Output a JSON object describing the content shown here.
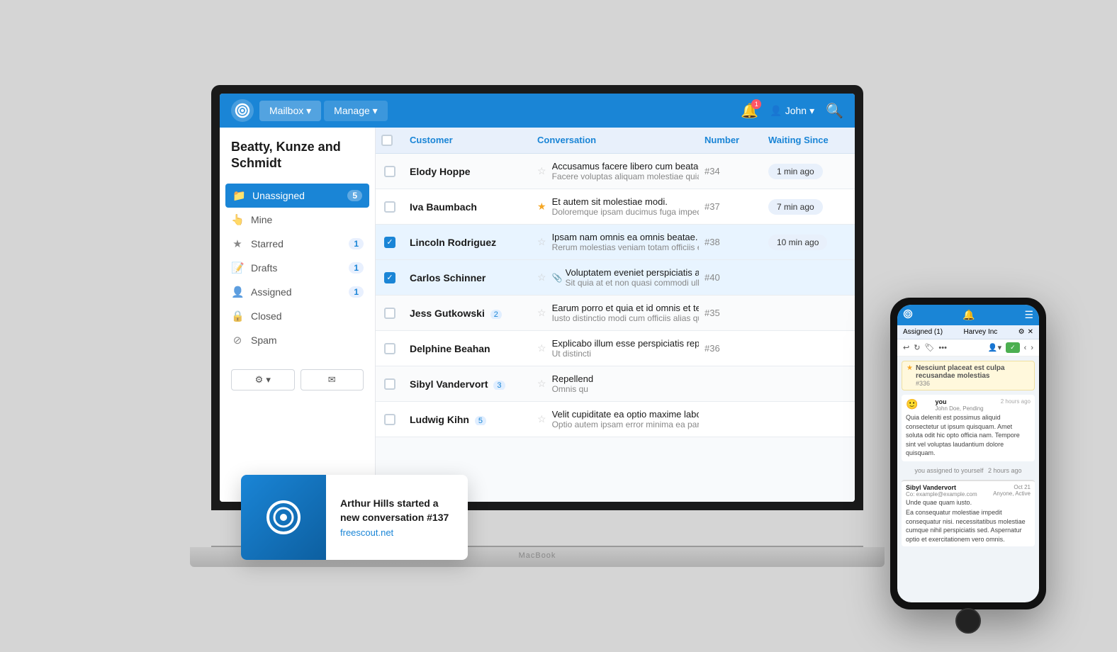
{
  "header": {
    "logo_text": "⟳",
    "nav_items": [
      {
        "label": "Mailbox ▾",
        "id": "mailbox"
      },
      {
        "label": "Manage ▾",
        "id": "manage"
      }
    ],
    "notification_count": "1",
    "user_name": "John",
    "search_label": "🔍"
  },
  "sidebar": {
    "company_name": "Beatty, Kunze and Schmidt",
    "items": [
      {
        "label": "Unassigned",
        "count": "5",
        "icon": "📁",
        "active": true,
        "id": "unassigned"
      },
      {
        "label": "Mine",
        "count": "",
        "icon": "👆",
        "active": false,
        "id": "mine"
      },
      {
        "label": "Starred",
        "count": "1",
        "icon": "★",
        "active": false,
        "id": "starred"
      },
      {
        "label": "Drafts",
        "count": "1",
        "icon": "📝",
        "active": false,
        "id": "drafts"
      },
      {
        "label": "Assigned",
        "count": "1",
        "icon": "👤",
        "active": false,
        "id": "assigned"
      },
      {
        "label": "Closed",
        "count": "",
        "icon": "🔒",
        "active": false,
        "id": "closed"
      },
      {
        "label": "Spam",
        "count": "",
        "icon": "⊘",
        "active": false,
        "id": "spam"
      }
    ],
    "footer_btn1": "⚙ ▾",
    "footer_btn2": "✉"
  },
  "table": {
    "columns": [
      "",
      "Customer",
      "Conversation",
      "Number",
      "Waiting Since"
    ],
    "rows": [
      {
        "id": 1,
        "checked": false,
        "starred": false,
        "customer": "Elody Hoppe",
        "customer_badge": "",
        "conv_title": "Accusamus facere libero cum beatae fugit a",
        "conv_preview": "Facere voluptas aliquam molestiae quia nisi offi",
        "has_attachment": false,
        "number": "#34",
        "waiting": "1 min ago"
      },
      {
        "id": 2,
        "checked": false,
        "starred": true,
        "customer": "Iva Baumbach",
        "customer_badge": "",
        "conv_title": "Et autem sit molestiae modi.",
        "conv_preview": "Doloremque ipsam ducimus fuga impedit rem.",
        "has_attachment": false,
        "number": "#37",
        "waiting": "7 min ago"
      },
      {
        "id": 3,
        "checked": true,
        "starred": false,
        "customer": "Lincoln Rodriguez",
        "customer_badge": "",
        "conv_title": "Ipsam nam omnis ea omnis beatae.",
        "conv_preview": "Rerum molestias veniam totam officiis et non.",
        "has_attachment": false,
        "number": "#38",
        "waiting": "10 min ago"
      },
      {
        "id": 4,
        "checked": true,
        "starred": false,
        "customer": "Carlos Schinner",
        "customer_badge": "",
        "conv_title": "Voluptatem eveniet perspiciatis aut illo iste",
        "conv_preview": "Sit quia at et non quasi commodi ullam. Et perf",
        "has_attachment": true,
        "number": "#40",
        "waiting": ""
      },
      {
        "id": 5,
        "checked": false,
        "starred": false,
        "customer": "Jess Gutkowski",
        "customer_badge": "2",
        "conv_title": "Earum porro et quia et id omnis et tenetur v",
        "conv_preview": "Iusto distinctio modi cum officiis alias qui beata",
        "has_attachment": false,
        "number": "#35",
        "waiting": ""
      },
      {
        "id": 6,
        "checked": false,
        "starred": false,
        "customer": "Delphine Beahan",
        "customer_badge": "",
        "conv_title": "Explicabo illum esse perspiciatis repellat no",
        "conv_preview": "Ut distincti",
        "has_attachment": false,
        "number": "#36",
        "waiting": ""
      },
      {
        "id": 7,
        "checked": false,
        "starred": false,
        "customer": "Sibyl Vandervort",
        "customer_badge": "3",
        "conv_title": "Repellend",
        "conv_preview": "Omnis qu",
        "has_attachment": false,
        "number": "",
        "waiting": ""
      },
      {
        "id": 8,
        "checked": false,
        "starred": false,
        "customer": "Ludwig Kihn",
        "customer_badge": "5",
        "conv_title": "Velit cupiditate ea optio maxime labore error be",
        "conv_preview": "Optio autem ipsam error minima ea pariatur ist",
        "has_attachment": false,
        "number": "",
        "waiting": ""
      }
    ]
  },
  "popup": {
    "notification": "Arthur Hills started a new conversation #137",
    "site": "freescout.net"
  },
  "phone": {
    "header_title": "Assigned (1)",
    "header_subtitle": "Harvey Inc",
    "conv_title": "Nesciunt placeat est culpa recusandae molestias",
    "conv_number": "#336",
    "message_from": "you",
    "message_time": "2 hours ago",
    "message_subtext": "John Doe, Pending",
    "message_text": "Quia deleniti est possimus aliquid consectetur ut ipsum quisquam. Amet soluta odit hic opto officia nam. Tempore sint vel voluptas laudantium dolore quisquam.",
    "assign_note": "you assigned to yourself",
    "assign_time": "2 hours ago",
    "contact_name": "Sibyl Vandervort",
    "contact_email": "Co: example@example.com",
    "contact_date": "Oct 21",
    "contact_audience": "Anyone, Active",
    "contact_text": "Unde quae quam iusto.",
    "contact_body": "Ea consequatur molestiae impedit consequatur nisi. necessitatibus molestiae cumque nihil perspiciatis sed. Aspernatur optio et exercitationem vero omnis."
  }
}
